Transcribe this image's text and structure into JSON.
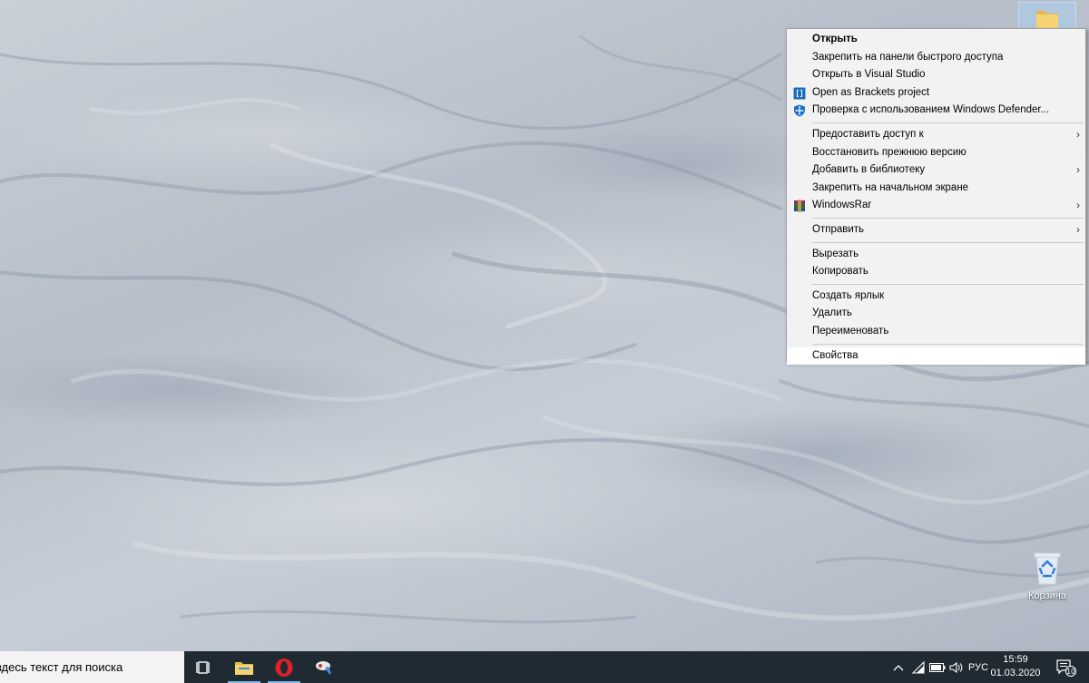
{
  "desktop": {
    "recycle_bin_label": "Корзина"
  },
  "context_menu": {
    "items": [
      {
        "label": "Открыть"
      },
      {
        "label": "Закрепить на панели быстрого доступа"
      },
      {
        "label": "Открыть в Visual Studio"
      },
      {
        "label": "Open as Brackets project",
        "icon": "brackets-icon"
      },
      {
        "label": "Проверка с использованием Windows Defender...",
        "icon": "windows-defender-icon"
      },
      {
        "label": "Предоставить доступ к"
      },
      {
        "label": "Восстановить прежнюю версию"
      },
      {
        "label": "Добавить в библиотеку"
      },
      {
        "label": "Закрепить на начальном экране"
      },
      {
        "label": "WindowsRar",
        "icon": "winrar-icon"
      },
      {
        "label": "Отправить"
      },
      {
        "label": "Вырезать"
      },
      {
        "label": "Копировать"
      },
      {
        "label": "Создать ярлык"
      },
      {
        "label": "Удалить"
      },
      {
        "label": "Переименовать"
      },
      {
        "label": "Свойства"
      }
    ],
    "submenu_arrow": "›"
  },
  "taskbar": {
    "search_placeholder": "Введите здесь текст для поиска",
    "language": "РУС",
    "time": "15:59",
    "date": "01.03.2020",
    "notification_count": "10"
  },
  "colors": {
    "taskbar_bg": "#1f2a33",
    "menu_bg": "#f2f2f2",
    "accent": "#7ab6ea"
  }
}
